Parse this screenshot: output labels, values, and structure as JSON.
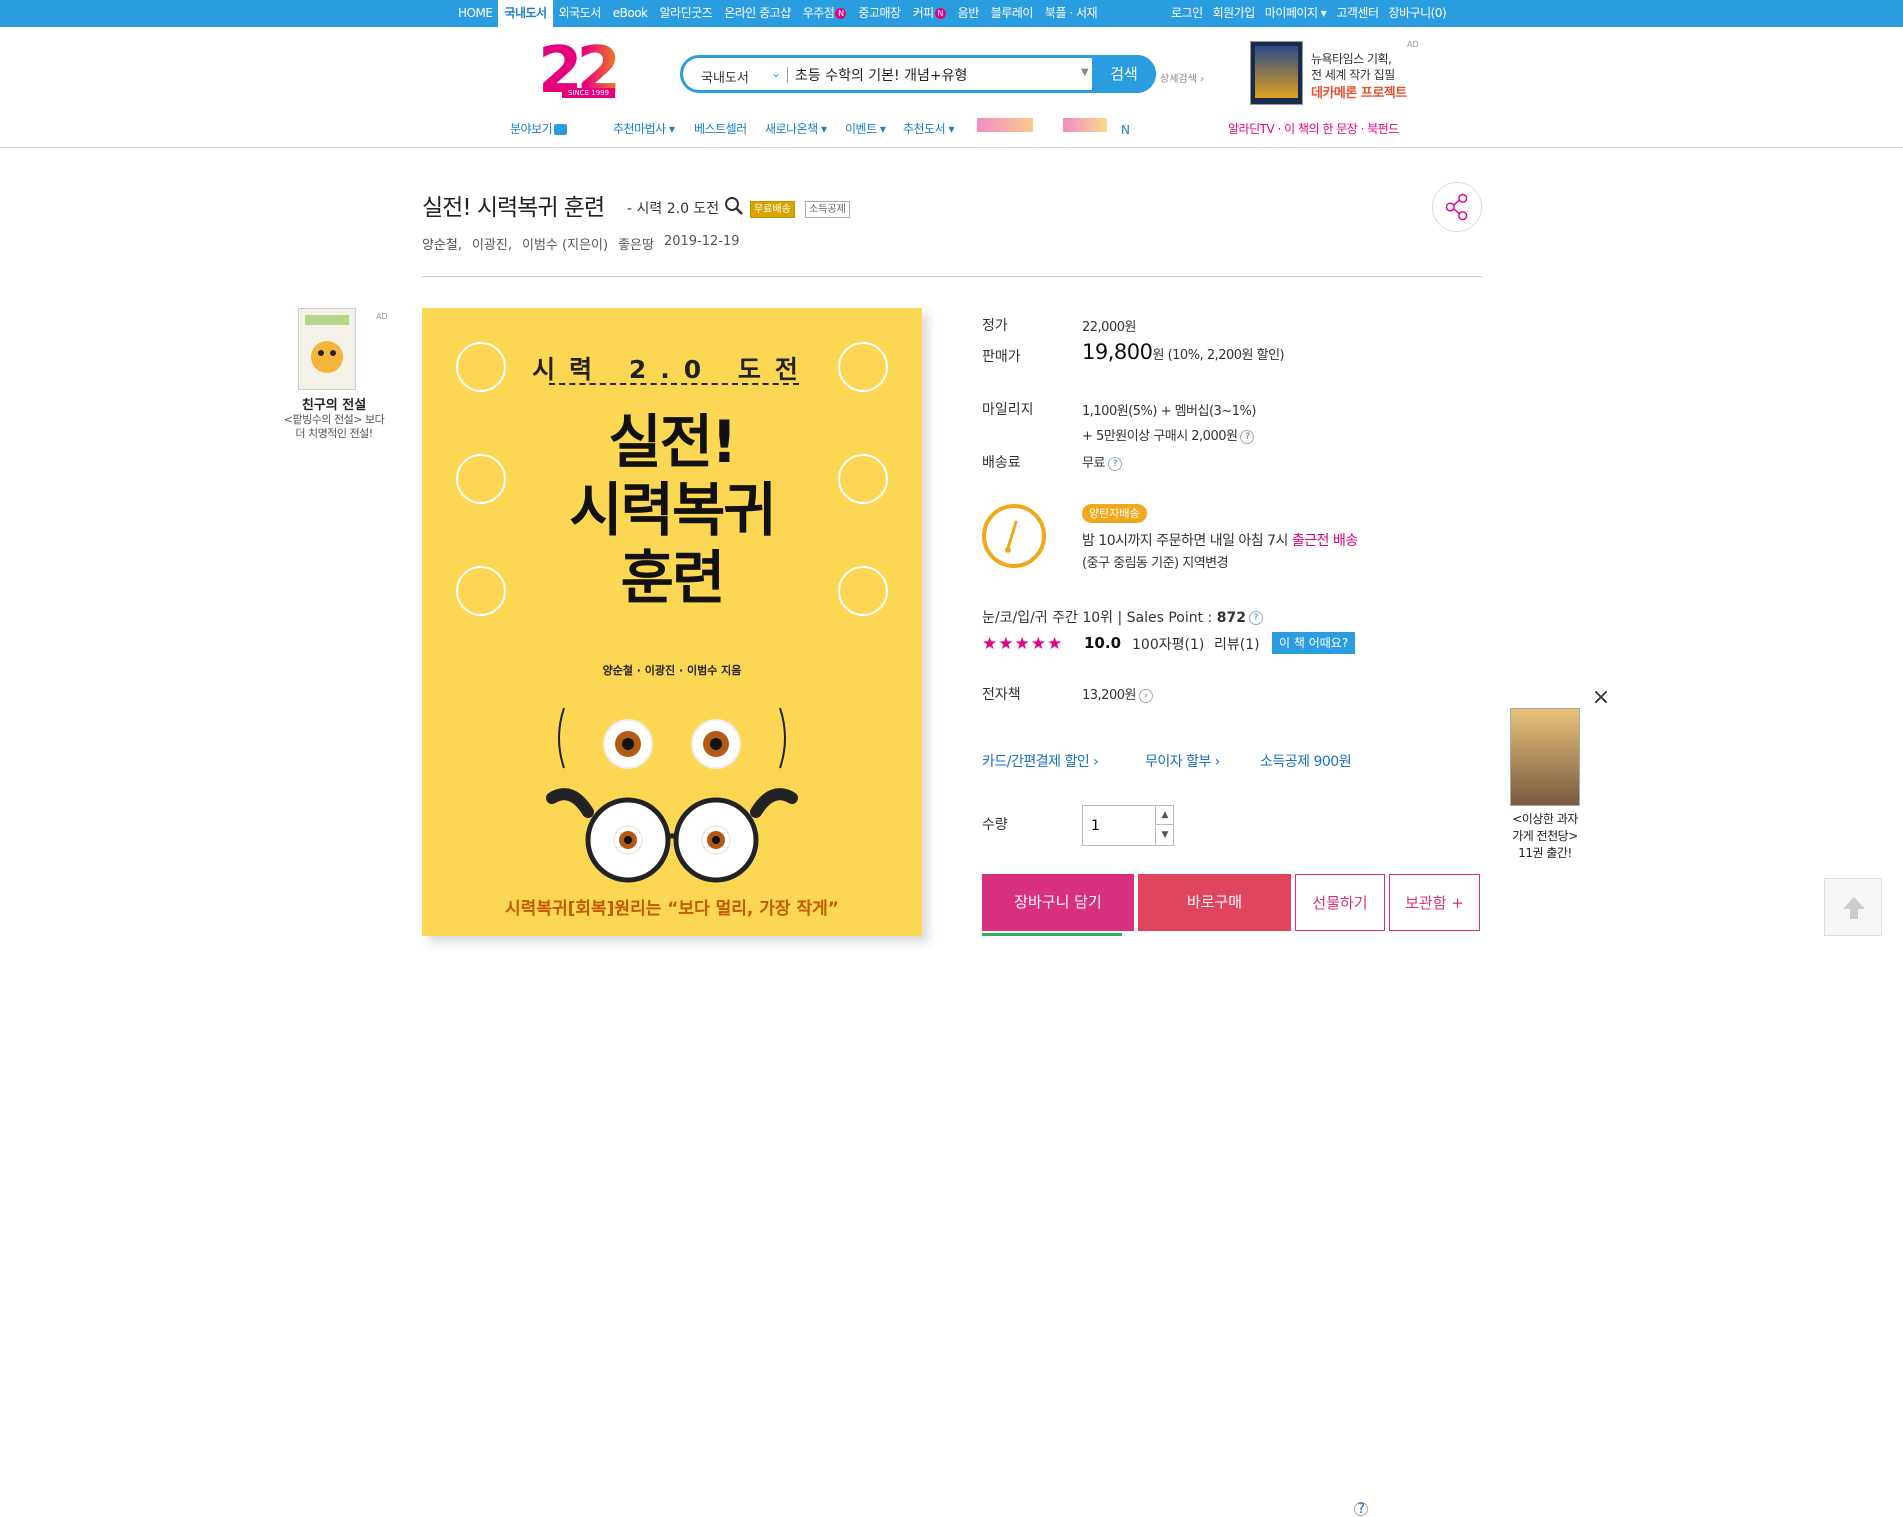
{
  "topnav": {
    "items": [
      "HOME",
      "국내도서",
      "외국도서",
      "eBook",
      "알라딘굿즈",
      "온라인 중고샵",
      "우주점",
      "중고매장",
      "커피",
      "음반",
      "블루레이",
      "북플 · 서재"
    ],
    "active_index": 1,
    "new_badge": "N",
    "right": [
      "로그인",
      "회원가입",
      "마이페이지 ▾",
      "고객센터",
      "장바구니(0)"
    ]
  },
  "logo": {
    "number": "22",
    "since": "SINCE 1999"
  },
  "search": {
    "category": "국내도서",
    "query": "초등 수학의 기본! 개념+유형",
    "button": "검색",
    "detail": "상세검색 ›"
  },
  "header_ad": {
    "line1": "뉴욕타임스 기획,",
    "line2": "전 세계 작가 집필",
    "line3": "데카메론 프로젝트",
    "ad": "AD"
  },
  "subnav": {
    "browse": "분야보기",
    "items": [
      "추천마법사 ▾",
      "베스트셀러",
      "새로나온책 ▾",
      "이벤트 ▾",
      "추천도서 ▾"
    ],
    "right": "알라딘TV · 이 책의 한 문장 · 북펀드",
    "badge": "N"
  },
  "product": {
    "title": "실전! 시력복귀 훈련",
    "subtitle": "- 시력 2.0 도전",
    "tag_free": "무료배송",
    "tag_tax": "소득공제",
    "authors": [
      "양순철,",
      "이광진,",
      "이범수 (지은이)"
    ],
    "publisher": "좋은땅",
    "date": "2019-12-19"
  },
  "left_ad": {
    "ad": "AD",
    "title": "친구의 전설",
    "desc1": "<팥빙수의 전설> 보다",
    "desc2": "더 치명적인 전설!"
  },
  "cover": {
    "top": "시력 2.0 도전",
    "main": [
      "실전!",
      "시력복귀",
      "훈련"
    ],
    "authors": "양순철 · 이광진 · 이범수 지음",
    "bottom": "시력복귀[회복]원리는 “보다 멀리, 가장 작게”"
  },
  "info": {
    "list_price_label": "정가",
    "list_price": "22,000원",
    "sale_label": "판매가",
    "sale_price": "19,800",
    "sale_unit": "원",
    "sale_note": "(10%, 2,200원 할인)",
    "mileage_label": "마일리지",
    "mileage1": "1,100원(5%) + 멤버십(3~1%)",
    "mileage2": "+ 5만원이상 구매시 2,000원",
    "ship_label": "배송료",
    "ship": "무료",
    "deliv_tag": "양탄자배송",
    "deliv1a": "밤 10시까지 주문하면 내일 아침 7시",
    "deliv1b": "출근전 배송",
    "deliv2": "(중구 중림동 기준) 지역변경",
    "rank": "눈/코/입/귀 주간 10위  |  Sales Point :",
    "sales_point": "872",
    "stars": "★★★★★",
    "rating": "10.0",
    "review100": "100자평(1)",
    "review": "리뷰(1)",
    "how": "이 책 어때요?",
    "ebook_label": "전자책",
    "ebook": "13,200원",
    "links": [
      "카드/간편결제 할인 ›",
      "무이자 할부 ›",
      "소득공제 900원"
    ],
    "qty_label": "수량",
    "qty": "1",
    "help": "?"
  },
  "buttons": {
    "cart": "장바구니 담기",
    "buy": "바로구매",
    "gift": "선물하기",
    "keep": "보관함 +"
  },
  "right_ad": {
    "close": "×",
    "t1": "<이상한 과자",
    "t2": "가게 전천당>",
    "t3": "11권 출간!"
  },
  "colors": {
    "brand_blue": "#2a9de0",
    "pink": "#e6007e",
    "yellow_cover": "#fcd753"
  }
}
